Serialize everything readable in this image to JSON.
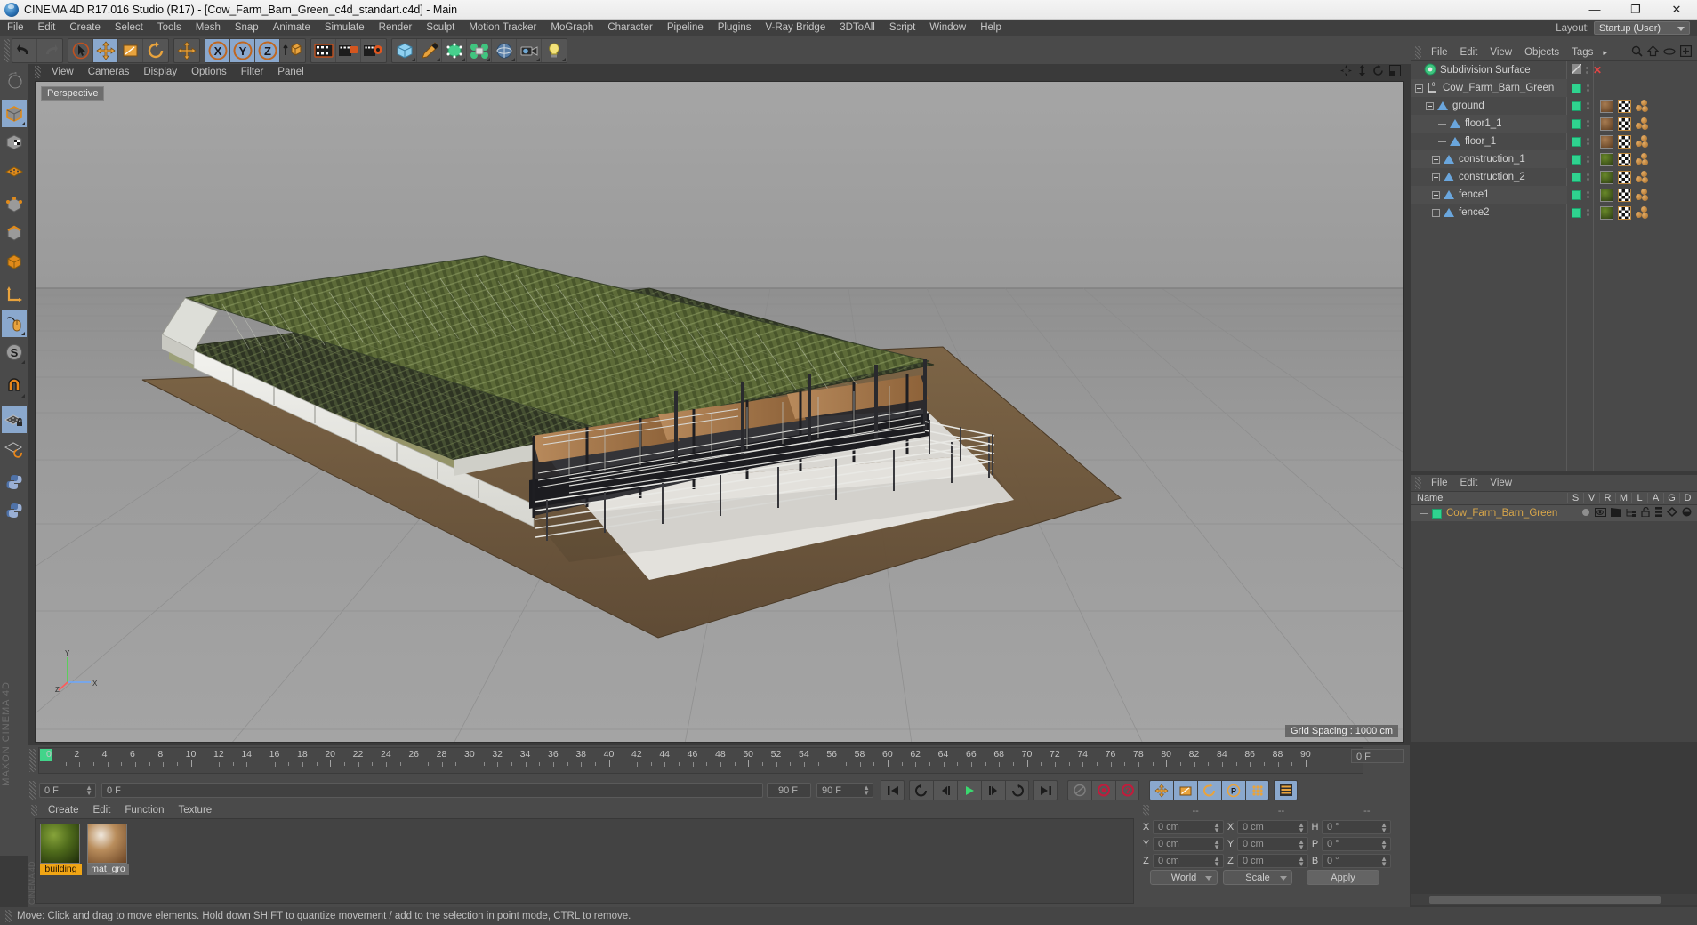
{
  "window": {
    "title": "CINEMA 4D R17.016 Studio (R17) - [Cow_Farm_Barn_Green_c4d_standart.c4d] - Main",
    "app_icon": "c4d-logo-icon",
    "minimize": "—",
    "maximize": "❐",
    "close": "✕"
  },
  "menubar": {
    "items": [
      "File",
      "Edit",
      "Create",
      "Select",
      "Tools",
      "Mesh",
      "Snap",
      "Animate",
      "Simulate",
      "Render",
      "Sculpt",
      "Motion Tracker",
      "MoGraph",
      "Character",
      "Pipeline",
      "Plugins",
      "V-Ray Bridge",
      "3DToAll",
      "Script",
      "Window",
      "Help"
    ],
    "layout_label": "Layout:",
    "layout_value": "Startup (User)"
  },
  "toolbar": {
    "groups": [
      {
        "name": "undo-redo",
        "buttons": [
          {
            "name": "undo-icon",
            "label": "Undo",
            "active": false
          },
          {
            "name": "redo-icon",
            "label": "Redo",
            "active": false
          }
        ]
      },
      {
        "name": "transform-tools",
        "buttons": [
          {
            "name": "live-selection-icon",
            "label": "Live Selection",
            "active": false
          },
          {
            "name": "move-tool-icon",
            "label": "Move",
            "active": true
          },
          {
            "name": "scale-tool-icon",
            "label": "Scale",
            "active": false
          },
          {
            "name": "rotate-tool-icon",
            "label": "Rotate",
            "active": false
          }
        ]
      },
      {
        "name": "move-dup",
        "buttons": [
          {
            "name": "move-alt-icon",
            "label": "Move",
            "active": false
          }
        ]
      },
      {
        "name": "axis-locks",
        "buttons": [
          {
            "name": "lock-x-axis-icon",
            "label": "X",
            "active": true
          },
          {
            "name": "lock-y-axis-icon",
            "label": "Y",
            "active": true
          },
          {
            "name": "lock-z-axis-icon",
            "label": "Z",
            "active": true
          },
          {
            "name": "world-object-coord-icon",
            "label": "World/Object",
            "active": false
          }
        ]
      },
      {
        "name": "render-tools",
        "buttons": [
          {
            "name": "render-view-icon",
            "label": "Render View",
            "active": false
          },
          {
            "name": "render-region-icon",
            "label": "Render to Picture Viewer",
            "active": false
          },
          {
            "name": "render-settings-icon",
            "label": "Edit Render Settings",
            "active": false
          }
        ]
      },
      {
        "name": "create-objects",
        "buttons": [
          {
            "name": "cube-primitive-icon",
            "label": "Cube",
            "active": false
          },
          {
            "name": "spline-pen-icon",
            "label": "Pen",
            "active": false
          },
          {
            "name": "generator-icon",
            "label": "Array",
            "active": false
          },
          {
            "name": "deformer-icon",
            "label": "Bend",
            "active": false
          },
          {
            "name": "environment-icon",
            "label": "Floor",
            "active": false
          },
          {
            "name": "camera-icon",
            "label": "Camera",
            "active": false
          },
          {
            "name": "light-icon",
            "label": "Light",
            "active": false
          }
        ]
      }
    ]
  },
  "left_toolbar": {
    "buttons": [
      {
        "name": "undo-view-icon",
        "label": "Undo View",
        "active": false
      },
      {
        "name": "make-editable-icon",
        "label": "Make Editable",
        "active": true
      },
      {
        "name": "model-mode-icon",
        "label": "Model Mode",
        "active": false
      },
      {
        "name": "texture-mode-icon",
        "label": "Texture Mode",
        "active": false
      },
      {
        "name": "points-mode-icon",
        "label": "Points",
        "active": false
      },
      {
        "name": "edges-mode-icon",
        "label": "Edges",
        "active": false
      },
      {
        "name": "polygons-mode-icon",
        "label": "Polygons",
        "active": false
      },
      {
        "name": "axis-modify-icon",
        "label": "Enable Axis",
        "active": false
      },
      {
        "name": "viewport-solo-icon",
        "label": "Viewport Solo Single",
        "active": true
      },
      {
        "name": "enable-snap-icon",
        "label": "Enable Snapping",
        "active": true
      },
      {
        "name": "magnet-icon",
        "label": "Magnet",
        "active": false
      },
      {
        "name": "workplane-lock-icon",
        "label": "Lock Workplane",
        "active": true
      },
      {
        "name": "workplane-rotate-icon",
        "label": "Planar Workplane",
        "active": false
      },
      {
        "name": "python-icon-1",
        "label": "Python Script",
        "active": false
      },
      {
        "name": "python-icon-2",
        "label": "Python Generator",
        "active": false
      }
    ],
    "brand": "MAXON  CINEMA 4D"
  },
  "viewport": {
    "menu": [
      "View",
      "Cameras",
      "Display",
      "Options",
      "Filter",
      "Panel"
    ],
    "camera_label": "Perspective",
    "grid_label": "Grid Spacing : 1000 cm",
    "icons": [
      "viewport-move-icon",
      "viewport-scale-icon",
      "viewport-rotate-icon",
      "viewport-maximize-icon"
    ],
    "axis_labels": {
      "y": "Y",
      "x": "X",
      "z": "Z"
    },
    "scene_description": "3D rendered green cow farm barn with metal roof, fences and ground plane"
  },
  "object_manager": {
    "menu": [
      "File",
      "Edit",
      "View",
      "Objects",
      "Tags"
    ],
    "menu_overflow": "▸",
    "right_icons": [
      "search-icon",
      "home-icon",
      "ellipse-icon",
      "add-layer-icon"
    ],
    "rows": [
      {
        "name": "Subdivision Surface",
        "indent": 0,
        "icon": "subdivision-surface-icon",
        "expander": "none",
        "visibility": "disabled",
        "tags": []
      },
      {
        "name": "Cow_Farm_Barn_Green",
        "indent": 0,
        "icon": "null-object-icon",
        "expander": "minus",
        "visibility": "enabled",
        "tags": []
      },
      {
        "name": "ground",
        "indent": 1,
        "icon": "polygon-object-icon",
        "expander": "minus",
        "visibility": "enabled",
        "tags": [
          "brown",
          "checker",
          "balls"
        ]
      },
      {
        "name": "floor1_1",
        "indent": 2,
        "icon": "polygon-object-icon",
        "expander": "none",
        "visibility": "enabled",
        "tags": [
          "brown",
          "checker",
          "balls"
        ]
      },
      {
        "name": "floor_1",
        "indent": 2,
        "icon": "polygon-object-icon",
        "expander": "none",
        "visibility": "enabled",
        "tags": [
          "brown",
          "checker",
          "balls"
        ]
      },
      {
        "name": "construction_1",
        "indent": 1,
        "icon": "polygon-object-icon",
        "expander": "plus",
        "visibility": "enabled",
        "tags": [
          "green",
          "checker",
          "balls"
        ]
      },
      {
        "name": "construction_2",
        "indent": 1,
        "icon": "polygon-object-icon",
        "expander": "plus",
        "visibility": "enabled",
        "tags": [
          "green",
          "checker",
          "balls"
        ]
      },
      {
        "name": "fence1",
        "indent": 1,
        "icon": "polygon-object-icon",
        "expander": "plus",
        "visibility": "enabled",
        "tags": [
          "green",
          "checker",
          "balls"
        ]
      },
      {
        "name": "fence2",
        "indent": 1,
        "icon": "polygon-object-icon",
        "expander": "plus",
        "visibility": "enabled",
        "tags": [
          "green",
          "checker",
          "balls"
        ]
      }
    ]
  },
  "layer_manager": {
    "menu": [
      "File",
      "Edit",
      "View"
    ],
    "columns": [
      "Name",
      "S",
      "V",
      "R",
      "M",
      "L",
      "A",
      "G",
      "D"
    ],
    "rows": [
      {
        "name": "Cow_Farm_Barn_Green",
        "color": "#2fd38f"
      }
    ]
  },
  "timeline": {
    "ticks": [
      0,
      2,
      4,
      6,
      8,
      10,
      12,
      14,
      16,
      18,
      20,
      22,
      24,
      26,
      28,
      30,
      32,
      34,
      36,
      38,
      40,
      42,
      44,
      46,
      48,
      50,
      52,
      54,
      56,
      58,
      60,
      62,
      64,
      66,
      68,
      70,
      72,
      74,
      76,
      78,
      80,
      82,
      84,
      86,
      88,
      90
    ],
    "current_frame_marker": 0,
    "right_field": "0 F"
  },
  "anim_bar": {
    "current_frame": "0 F",
    "preview_start": "0 F",
    "preview_end": "90 F",
    "max_frame": "90 F",
    "transport": [
      {
        "name": "goto-start-button",
        "label": "|◀◀"
      },
      {
        "name": "play-reverse-loop-button",
        "label": "↺"
      },
      {
        "name": "step-back-button",
        "label": "◀|"
      },
      {
        "name": "play-button",
        "label": "▶"
      },
      {
        "name": "step-forward-button",
        "label": "|▶"
      },
      {
        "name": "loop-button",
        "label": "↷"
      },
      {
        "name": "goto-end-button",
        "label": "▶▶|"
      }
    ],
    "record_tools": [
      {
        "name": "autokey-button",
        "label": "autokey",
        "active": false
      },
      {
        "name": "record-active-objects-button",
        "label": "record",
        "active": false
      },
      {
        "name": "keyframe-selection-button",
        "label": "?",
        "active": false
      }
    ],
    "key_tools": [
      {
        "name": "position-key-button",
        "label": "pos",
        "active": true
      },
      {
        "name": "scale-key-button",
        "label": "scale",
        "active": true
      },
      {
        "name": "rotation-key-button",
        "label": "rot",
        "active": true
      },
      {
        "name": "param-key-button",
        "label": "P",
        "active": true
      },
      {
        "name": "pla-key-button",
        "label": "pla",
        "active": true
      }
    ]
  },
  "material_manager": {
    "menu": [
      "Create",
      "Edit",
      "Function",
      "Texture"
    ],
    "materials": [
      {
        "name": "building",
        "full_name": "building",
        "selected": true,
        "swatch": "green"
      },
      {
        "name": "mat_gro",
        "full_name": "mat_gro",
        "selected": false,
        "swatch": "brown"
      }
    ],
    "side_brand": "CINEMA 4D"
  },
  "coordinates": {
    "headers": [
      "--",
      "--",
      "--"
    ],
    "position": {
      "labels": [
        "X",
        "Y",
        "Z"
      ],
      "values": [
        "0 cm",
        "0 cm",
        "0 cm"
      ]
    },
    "size": {
      "labels": [
        "X",
        "Y",
        "Z"
      ],
      "values": [
        "0 cm",
        "0 cm",
        "0 cm"
      ]
    },
    "rotation": {
      "labels": [
        "H",
        "P",
        "B"
      ],
      "values": [
        "0 °",
        "0 °",
        "0 °"
      ]
    },
    "coord_system": "World",
    "size_mode": "Scale",
    "apply_label": "Apply"
  },
  "status_bar": {
    "message": "Move: Click and drag to move elements. Hold down SHIFT to quantize movement / add to the selection in point mode, CTRL to remove."
  },
  "colors": {
    "panel_bg": "#4a4a4a",
    "panel_dark": "#3f3f3f",
    "accent_blue": "#8aa8cd",
    "accent_green": "#2fd38f",
    "accent_orange": "#f0a515",
    "text": "#c8c8c8"
  }
}
